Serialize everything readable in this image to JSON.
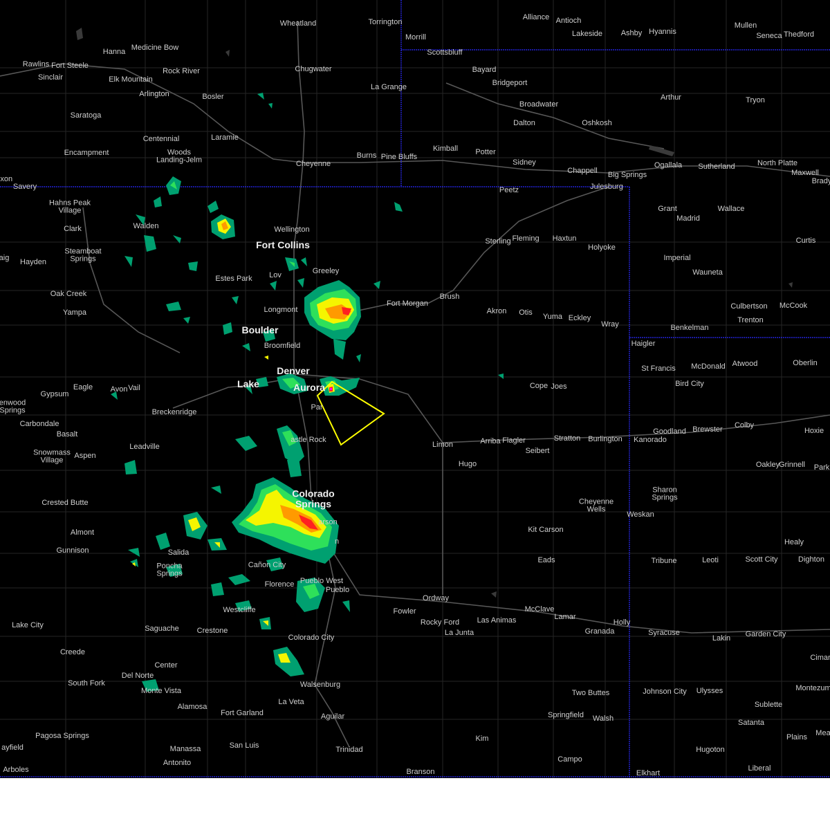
{
  "map": {
    "layers": [
      "county-lines",
      "state-borders",
      "highways",
      "radar-reflectivity",
      "warning-polygon"
    ],
    "colors": {
      "background": "#000000",
      "state_border": "#2b2bff",
      "county_line": "#2a2a2a",
      "highway": "#585858",
      "warning_polygon": "#ffff00",
      "radar_light": "#00a070",
      "radar_green": "#2ee05a",
      "radar_yellow": "#f5f500",
      "radar_orange": "#ff9a00",
      "radar_red": "#ff2020",
      "radar_magenta": "#ff00ff",
      "labels": "#cfcfcf"
    }
  },
  "cities": {
    "wheatland": "Wheatland",
    "torrington": "Torrington",
    "alliance": "Alliance",
    "antioch": "Antioch",
    "mullen": "Mullen",
    "hanna": "Hanna",
    "medicine_bow": "Medicine Bow",
    "morrill": "Morrill",
    "lakeside": "Lakeside",
    "ashby": "Ashby",
    "hyannis": "Hyannis",
    "seneca": "Seneca",
    "thedford": "Thedford",
    "rawlins": "Rawlins",
    "fort_steele": "Fort Steele",
    "scottsbluff": "Scottsbluff",
    "sinclair": "Sinclair",
    "rock_river": "Rock River",
    "elk_mountain": "Elk Mountain",
    "chugwater": "Chugwater",
    "bayard": "Bayard",
    "bridgeport": "Bridgeport",
    "la_grange": "La Grange",
    "arlington": "Arlington",
    "bosler": "Bosler",
    "arthur": "Arthur",
    "tryon": "Tryon",
    "broadwater": "Broadwater",
    "saratoga": "Saratoga",
    "dalton": "Dalton",
    "oshkosh": "Oshkosh",
    "centennial": "Centennial",
    "laramie": "Laramie",
    "kimball": "Kimball",
    "encampment": "Encampment",
    "burns": "Burns",
    "pine_bluffs": "Pine Bluffs",
    "potter": "Potter",
    "woods_landing_jelm": "Woods\nLanding-Jelm",
    "cheyenne": "Cheyenne",
    "sidney": "Sidney",
    "ogallala": "Ogallala",
    "sutherland": "Sutherland",
    "north_platte": "North Platte",
    "maxwell": "Maxwell",
    "chappell": "Chappell",
    "big_springs": "Big Springs",
    "brady": "Brady",
    "dixon": "ixon",
    "savery": "Savery",
    "julesburg": "Julesburg",
    "peetz": "Peetz",
    "hahns_peak_village": "Hahns Peak\nVillage",
    "grant": "Grant",
    "wallace": "Wallace",
    "madrid": "Madrid",
    "clark": "Clark",
    "walden": "Walden",
    "wellington": "Wellington",
    "steamboat_springs": "Steamboat\nSprings",
    "fort_collins": "Fort Collins",
    "sterling": "Sterling",
    "fleming": "Fleming",
    "haxtun": "Haxtun",
    "holyoke": "Holyoke",
    "curtis": "Curtis",
    "craig": "aig",
    "hayden": "Hayden",
    "imperial": "Imperial",
    "estes_park": "Estes Park",
    "loveland": "Lov",
    "greeley": "Greeley",
    "wauneta": "Wauneta",
    "oak_creek": "Oak Creek",
    "fort_morgan": "Fort Morgan",
    "brush": "Brush",
    "culbertson": "Culbertson",
    "mccook": "McCook",
    "yampa": "Yampa",
    "longmont": "Longmont",
    "akron": "Akron",
    "otis": "Otis",
    "yuma": "Yuma",
    "eckley": "Eckley",
    "trenton": "Trenton",
    "wray": "Wray",
    "benkelman": "Benkelman",
    "boulder": "Boulder",
    "haigler": "Haigler",
    "broomfield": "Broomfield",
    "st_francis": "St Francis",
    "mcdonald": "McDonald",
    "atwood": "Atwood",
    "oberlin": "Oberlin",
    "denver": "Denver",
    "bird_city": "Bird City",
    "eagle": "Eagle",
    "avon": "Avon",
    "vail": "Vail",
    "lakewood": "Lake",
    "aurora": "Aurora",
    "cope": "Cope",
    "joes": "Joes",
    "gypsum": "Gypsum",
    "glenwood_springs": "enwood\nSprings",
    "breckenridge": "Breckenridge",
    "parker": "Par",
    "carbondale": "Carbondale",
    "goodland": "Goodland",
    "brewster": "Brewster",
    "colby": "Colby",
    "basalt": "Basalt",
    "castle_rock": "astle Rock",
    "hoxie": "Hoxie",
    "limon": "Limon",
    "arriba": "Arriba",
    "flagler": "Flagler",
    "stratton": "Stratton",
    "burlington": "Burlington",
    "kanorado": "Kanorado",
    "leadville": "Leadville",
    "seibert": "Seibert",
    "snowmass_village": "Snowmass\nVillage",
    "aspen": "Aspen",
    "hugo": "Hugo",
    "oakley": "Oakley",
    "grinnell": "Grinnell",
    "park": "Park",
    "sharon_springs": "Sharon\nSprings",
    "colorado_springs": "Colorado\nSprings",
    "cheyenne_wells": "Cheyenne\nWells",
    "crested_butte": "Crested Butte",
    "weskan": "Weskan",
    "fountain_partial": "arson",
    "kit_carson": "Kit Carson",
    "almont": "Almont",
    "healy": "Healy",
    "gunnison": "Gunnison",
    "salida": "Salida",
    "eads": "Eads",
    "tribune": "Tribune",
    "leoti": "Leoti",
    "scott_city": "Scott City",
    "dighton": "Dighton",
    "poncha_springs": "Poncha\nSprings",
    "canon_city": "Cañon City",
    "pueblo_west": "Pueblo West",
    "florence": "Florence",
    "pueblo": "Pueblo",
    "ordway": "Ordway",
    "mcclave": "McClave",
    "westcliffe": "Westcliffe",
    "fowler": "Fowler",
    "rocky_ford": "Rocky Ford",
    "las_animas": "Las Animas",
    "lamar": "Lamar",
    "holly": "Holly",
    "saguache": "Saguache",
    "crestone": "Crestone",
    "la_junta": "La Junta",
    "granada": "Granada",
    "syracuse": "Syracuse",
    "lakin": "Lakin",
    "garden_city": "Garden City",
    "lake_city": "Lake City",
    "colorado_city": "Colorado City",
    "creede": "Creede",
    "center": "Center",
    "cimarron": "Cimar",
    "del_norte": "Del Norte",
    "south_fork": "South Fork",
    "walsenburg": "Walsenburg",
    "monte_vista": "Monte Vista",
    "two_buttes": "Two Buttes",
    "johnson_city": "Johnson City",
    "ulysses": "Ulysses",
    "montezuma": "Montezum",
    "alamosa": "Alamosa",
    "la_veta": "La Veta",
    "fort_garland": "Fort Garland",
    "aguilar": "Aguilar",
    "sublette": "Sublette",
    "springfield": "Springfield",
    "walsh": "Walsh",
    "satanta": "Satanta",
    "pagosa_springs": "Pagosa Springs",
    "plains": "Plains",
    "meade": "Mea",
    "kim": "Kim",
    "bayfield": "ayfield",
    "san_luis": "San Luis",
    "manassa": "Manassa",
    "trinidad": "Trinidad",
    "hugoton": "Hugoton",
    "campo": "Campo",
    "antonito": "Antonito",
    "arboles": "Arboles",
    "branson": "Branson",
    "elkhart": "Elkhart",
    "liberal": "Liberal",
    "fountain": "n"
  }
}
